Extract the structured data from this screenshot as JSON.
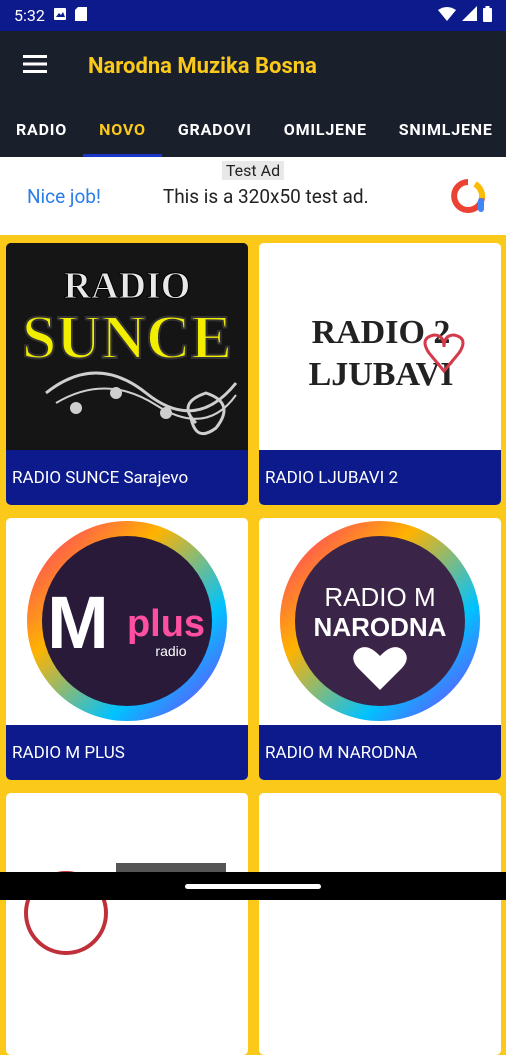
{
  "status_bar": {
    "time": "5:32"
  },
  "app_bar": {
    "title": "Narodna Muzika Bosna"
  },
  "tabs": [
    {
      "label": "RADIO"
    },
    {
      "label": "NOVO"
    },
    {
      "label": "GRADOVI"
    },
    {
      "label": "OMILJENE"
    },
    {
      "label": "SNIMLJENE"
    }
  ],
  "ad": {
    "label": "Test Ad",
    "headline": "Nice job!",
    "text": "This is a 320x50 test ad."
  },
  "stations": [
    {
      "name": "RADIO SUNCE Sarajevo",
      "logo_line1": "RADIO",
      "logo_line2": "SUNCE"
    },
    {
      "name": "RADIO LJUBAVI 2",
      "logo_line1": "RADIO 2",
      "logo_line2": "LJUBAVI"
    },
    {
      "name": "RADIO M PLUS",
      "logo_line1": "M",
      "logo_line2": "plus",
      "logo_line3": "radio"
    },
    {
      "name": "RADIO M NARODNA",
      "logo_line1": "RADIO M",
      "logo_line2": "NARODNA"
    },
    {
      "name": ""
    },
    {
      "name": ""
    }
  ],
  "colors": {
    "accent": "#fbc91a",
    "bar": "#1a1f2c",
    "caption": "#0d1a8c",
    "status": "#0d1a8c"
  }
}
